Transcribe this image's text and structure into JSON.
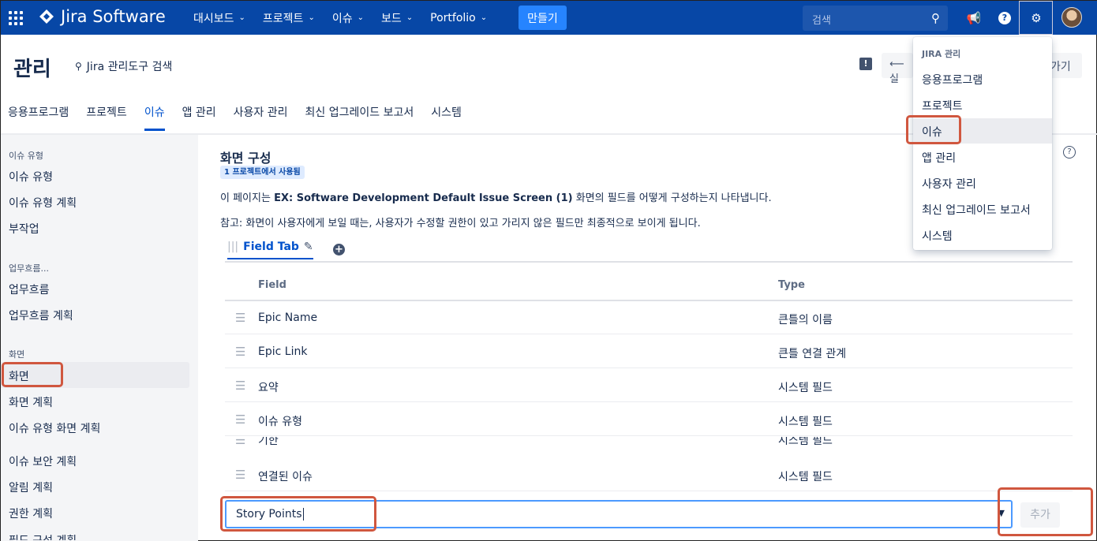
{
  "topnav": {
    "logo_text": "Jira Software",
    "items": [
      {
        "label": "대시보드"
      },
      {
        "label": "프로젝트"
      },
      {
        "label": "이슈"
      },
      {
        "label": "보드"
      },
      {
        "label": "Portfolio"
      }
    ],
    "create_label": "만들기",
    "search_placeholder": "검색",
    "brand_color": "#0747a6"
  },
  "header": {
    "title": "관리",
    "admin_search": "Jira 관리도구 검색",
    "back_label": "⟵ 실",
    "back_label2": "가기"
  },
  "tabs": [
    {
      "label": "응용프로그램"
    },
    {
      "label": "프로젝트"
    },
    {
      "label": "이슈",
      "active": true
    },
    {
      "label": "앱 관리"
    },
    {
      "label": "사용자 관리"
    },
    {
      "label": "최신 업그레이드 보고서"
    },
    {
      "label": "시스템"
    }
  ],
  "sidebar": {
    "sections": [
      {
        "heading": "이슈 유형",
        "items": [
          "이슈 유형",
          "이슈 유형 계획",
          "부작업"
        ]
      },
      {
        "heading": "업무흐름...",
        "items": [
          "업무흐름",
          "업무흐름 계획"
        ]
      },
      {
        "heading": "화면",
        "items": [
          "화면",
          "화면 계획",
          "이슈 유형 화면 계획"
        ]
      },
      {
        "heading": "",
        "items": [
          "이슈 보안 계획",
          "알림 계획",
          "권한 계획",
          "필드 구성 계획"
        ]
      }
    ],
    "active_item": "화면"
  },
  "main": {
    "title": "화면 구성",
    "lozenge": "1 프로젝트에서 사용됨",
    "desc_prefix": "이 페이지는 ",
    "desc_bold": "EX: Software Development Default Issue Screen (1)",
    "desc_suffix": " 화면의 필드를 어떻게 구성하는지 나타냅니다.",
    "note": "참고: 화면이 사용자에게 보일 때는, 사용자가 수정할 권한이 있고 가리지 않은 필드만 최종적으로 보이게 됩니다.",
    "field_tab": "Field Tab",
    "columns": {
      "field": "Field",
      "type": "Type"
    },
    "rows": [
      {
        "name": "Epic Name",
        "type": "큰틀의 이름"
      },
      {
        "name": "Epic Link",
        "type": "큰틀 연결 관계"
      },
      {
        "name": "요약",
        "type": "시스템 필드"
      },
      {
        "name": "이슈 유형",
        "type": "시스템 필드"
      },
      {
        "name": "기한",
        "type": "시스템 필드"
      },
      {
        "name": "연결된 이슈",
        "type": "시스템 필드"
      }
    ],
    "add_field_value": "Story Points",
    "add_button": "추가"
  },
  "dropdown": {
    "heading": "JIRA 관리",
    "items": [
      {
        "label": "응용프로그램"
      },
      {
        "label": "프로젝트"
      },
      {
        "label": "이슈",
        "active": true
      },
      {
        "label": "앱 관리"
      },
      {
        "label": "사용자 관리"
      },
      {
        "label": "최신 업그레이드 보고서"
      },
      {
        "label": "시스템"
      }
    ]
  },
  "highlight_color": "#d0573f"
}
